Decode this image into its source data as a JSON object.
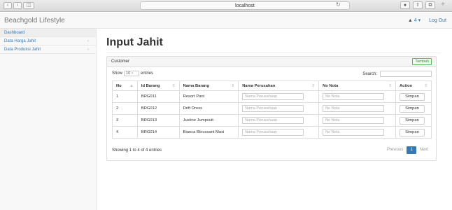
{
  "browser": {
    "address": "localhost",
    "nav_icons": [
      "back-icon",
      "forward-icon",
      "sidebar-icon"
    ],
    "tool_icons": [
      "download-icon",
      "share-icon",
      "tabs-icon"
    ]
  },
  "navbar": {
    "brand": "Beachgold Lifestyle",
    "notif_label": "4",
    "logout_label": "Log Out"
  },
  "sidebar": {
    "items": [
      {
        "label": "Dashboard"
      },
      {
        "label": "Data Harga Jahit"
      },
      {
        "label": "Data Produksi Jahit"
      }
    ]
  },
  "page": {
    "title": "Input Jahit"
  },
  "panel": {
    "title": "Customer",
    "add_label": "Tambah",
    "show_label": "Show",
    "entries_value": "10",
    "entries_label": "entries",
    "search_label": "Search:",
    "columns": [
      "No",
      "Id Barang",
      "Nama Barang",
      "Nama Perusahan",
      "No Nota",
      "Action"
    ],
    "rows": [
      {
        "no": "1",
        "id": "BRG011",
        "nama": "Resort Pant"
      },
      {
        "no": "2",
        "id": "BRG012",
        "nama": "Drift Dress"
      },
      {
        "no": "3",
        "id": "BRG013",
        "nama": "Justine Jumpsuit"
      },
      {
        "no": "4",
        "id": "BRG014",
        "nama": "Bianca Bloussant Maxi"
      }
    ],
    "perusahan_placeholder": "Nama Perusahaan",
    "nota_placeholder": "No Nota",
    "save_label": "Simpan",
    "info": "Showing 1 to 4 of 4 entries",
    "prev_label": "Previous",
    "page_label": "1",
    "next_label": "Next"
  }
}
